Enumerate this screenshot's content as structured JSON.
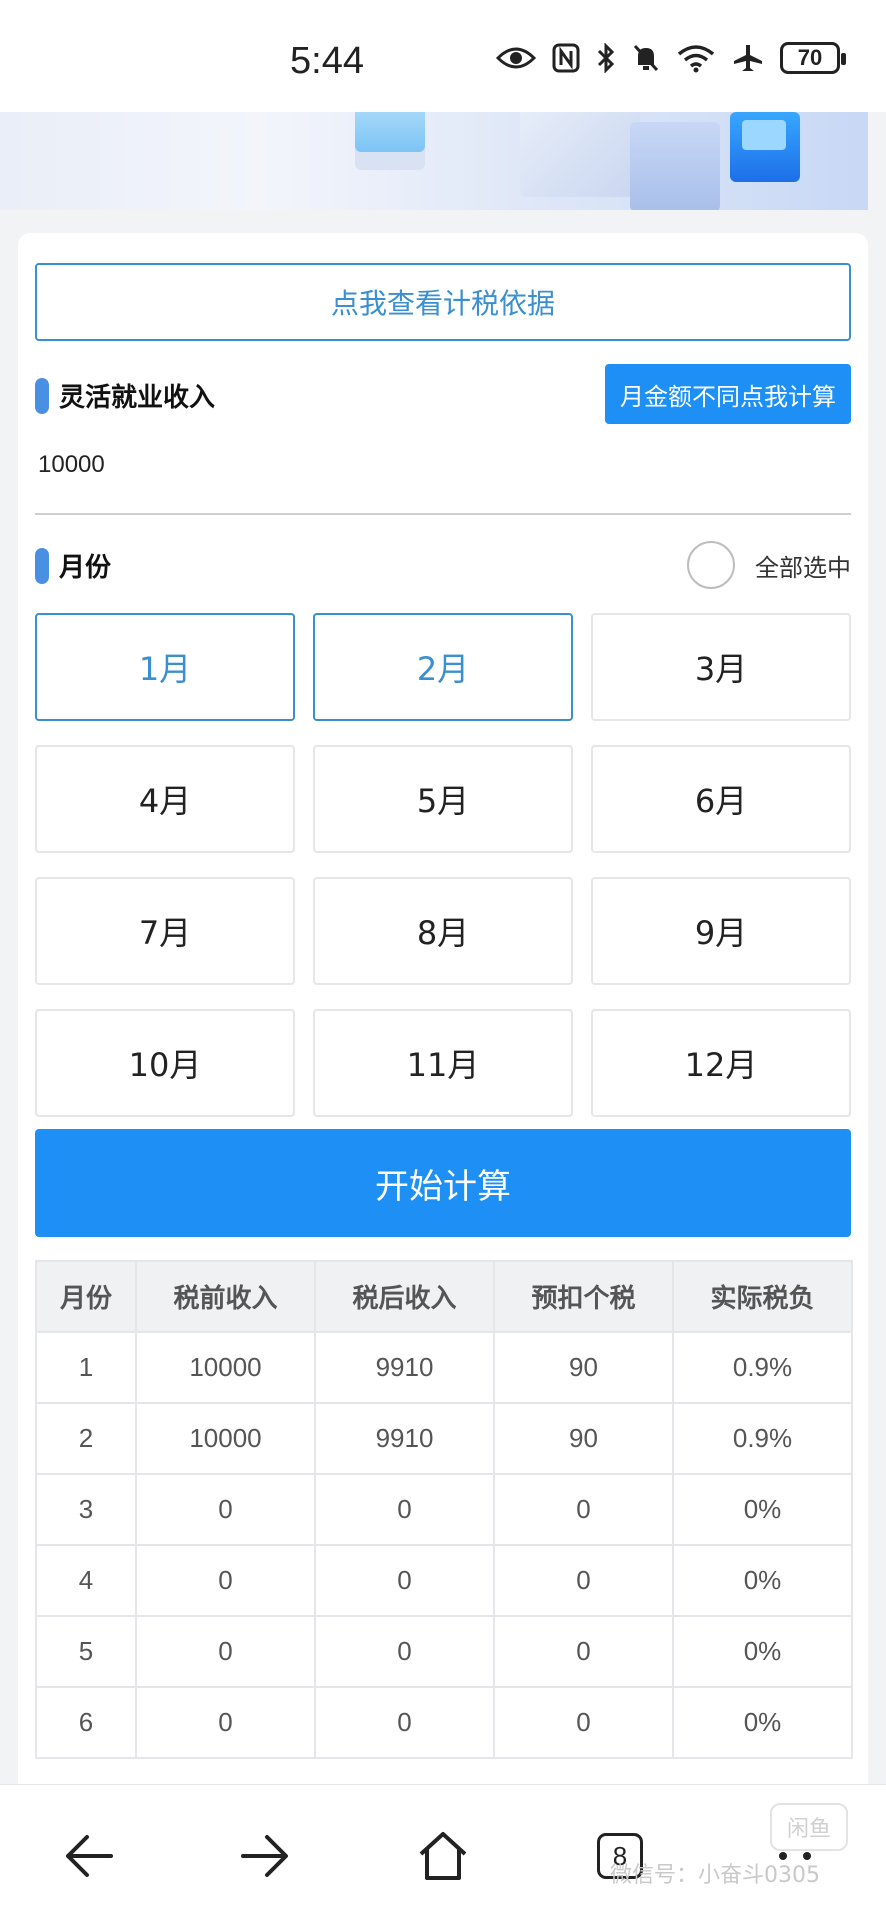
{
  "status_bar": {
    "time": "5:44",
    "battery": "70",
    "icons": [
      "eye-icon",
      "nfc-icon",
      "bluetooth-icon",
      "mute-bell-icon",
      "wifi-icon",
      "airplane-icon",
      "battery-icon"
    ]
  },
  "calc": {
    "basis_button": "点我查看计税依据",
    "income_label": "灵活就业收入",
    "monthly_diff_button": "月金额不同点我计算",
    "income_value": "10000",
    "month_label": "月份",
    "select_all": "全部选中",
    "months": [
      {
        "label": "1月",
        "selected": true
      },
      {
        "label": "2月",
        "selected": true
      },
      {
        "label": "3月",
        "selected": false
      },
      {
        "label": "4月",
        "selected": false
      },
      {
        "label": "5月",
        "selected": false
      },
      {
        "label": "6月",
        "selected": false
      },
      {
        "label": "7月",
        "selected": false
      },
      {
        "label": "8月",
        "selected": false
      },
      {
        "label": "9月",
        "selected": false
      },
      {
        "label": "10月",
        "selected": false
      },
      {
        "label": "11月",
        "selected": false
      },
      {
        "label": "12月",
        "selected": false
      }
    ],
    "start_button": "开始计算"
  },
  "table": {
    "headers": [
      "月份",
      "税前收入",
      "税后收入",
      "预扣个税",
      "实际税负"
    ],
    "rows": [
      [
        "1",
        "10000",
        "9910",
        "90",
        "0.9%"
      ],
      [
        "2",
        "10000",
        "9910",
        "90",
        "0.9%"
      ],
      [
        "3",
        "0",
        "0",
        "0",
        "0%"
      ],
      [
        "4",
        "0",
        "0",
        "0",
        "0%"
      ],
      [
        "5",
        "0",
        "0",
        "0",
        "0%"
      ],
      [
        "6",
        "0",
        "0",
        "0",
        "0%"
      ]
    ]
  },
  "bottom_nav": {
    "tab_count": "8",
    "watermark_text": "微信号：小奋斗0305",
    "watermark_logo": "闲鱼"
  },
  "colors": {
    "accent": "#1e90f5",
    "outline_blue": "#3a8fd0",
    "section_bar": "#4a90e2"
  }
}
